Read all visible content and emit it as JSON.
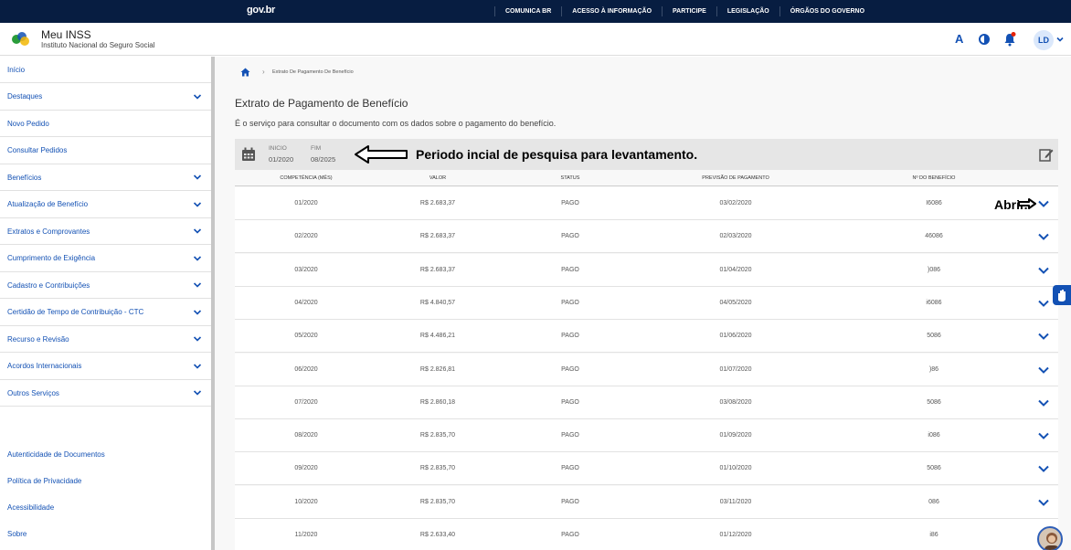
{
  "govbar": {
    "logo": "gov.br",
    "links": [
      "COMUNICA BR",
      "ACESSO À INFORMAÇÃO",
      "PARTICIPE",
      "LEGISLAÇÃO",
      "ÓRGÃOS DO GOVERNO"
    ]
  },
  "header": {
    "title": "Meu INSS",
    "subtitle": "Instituto Nacional do Seguro Social",
    "font_size_label": "A",
    "avatar_initials": "LD"
  },
  "sidebar": {
    "items": [
      {
        "label": "Início",
        "icon": ""
      },
      {
        "label": "Destaques",
        "icon": "chevron-down-icon"
      },
      {
        "label": "Novo Pedido",
        "icon": ""
      },
      {
        "label": "Consultar Pedidos",
        "icon": ""
      },
      {
        "label": "Benefícios",
        "icon": "chevron-down-icon"
      },
      {
        "label": "Atualização de Benefício",
        "icon": "chevron-down-icon"
      },
      {
        "label": "Extratos e Comprovantes",
        "icon": "chevron-down-icon"
      },
      {
        "label": "Cumprimento de Exigência",
        "icon": "chevron-down-icon"
      },
      {
        "label": "Cadastro e Contribuições",
        "icon": "chevron-down-icon"
      },
      {
        "label": "Certidão de Tempo de Contribuição - CTC",
        "icon": "chevron-down-icon"
      },
      {
        "label": "Recurso e Revisão",
        "icon": "chevron-down-icon"
      },
      {
        "label": "Acordos Internacionais",
        "icon": "chevron-down-icon"
      },
      {
        "label": "Outros Serviços",
        "icon": "chevron-down-icon"
      }
    ],
    "footer_links": [
      "Autenticidade de Documentos",
      "Política de Privacidade",
      "Acessibilidade",
      "Sobre"
    ]
  },
  "breadcrumb": {
    "current": "Extrato De Pagamento De Benefício"
  },
  "page": {
    "title": "Extrato de Pagamento de Benefício",
    "description": "É o serviço para consultar o documento com os dados sobre o pagamento do benefício."
  },
  "period": {
    "start_label": "INICIO",
    "start_value": "01/2020",
    "end_label": "FIM",
    "end_value": "08/2025",
    "annotation": "Periodo incial de pesquisa para levantamento."
  },
  "table": {
    "headers": [
      "COMPETÊNCIA (MÊS)",
      "VALOR",
      "STATUS",
      "PREVISÃO DE PAGAMENTO",
      "Nº DO BENEFÍCIO"
    ],
    "rows": [
      [
        "01/2020",
        "R$ 2.683,37",
        "PAGO",
        "03/02/2020",
        "I6086"
      ],
      [
        "02/2020",
        "R$ 2.683,37",
        "PAGO",
        "02/03/2020",
        "46086"
      ],
      [
        "03/2020",
        "R$ 2.683,37",
        "PAGO",
        "01/04/2020",
        ")086"
      ],
      [
        "04/2020",
        "R$ 4.840,57",
        "PAGO",
        "04/05/2020",
        "i6086"
      ],
      [
        "05/2020",
        "R$ 4.486,21",
        "PAGO",
        "01/06/2020",
        "5086"
      ],
      [
        "06/2020",
        "R$ 2.826,81",
        "PAGO",
        "01/07/2020",
        ")86"
      ],
      [
        "07/2020",
        "R$ 2.860,18",
        "PAGO",
        "03/08/2020",
        "5086"
      ],
      [
        "08/2020",
        "R$ 2.835,70",
        "PAGO",
        "01/09/2020",
        "i086"
      ],
      [
        "09/2020",
        "R$ 2.835,70",
        "PAGO",
        "01/10/2020",
        "5086"
      ],
      [
        "10/2020",
        "R$ 2.835,70",
        "PAGO",
        "03/11/2020",
        "086"
      ],
      [
        "11/2020",
        "R$ 2.633,40",
        "PAGO",
        "01/12/2020",
        "i86"
      ]
    ],
    "open_annotation": "Abrir."
  },
  "colors": {
    "govbar": "#071d41",
    "accent": "#1351b4",
    "background": "#f8f8f8",
    "period_bar": "#e6e6e6"
  }
}
